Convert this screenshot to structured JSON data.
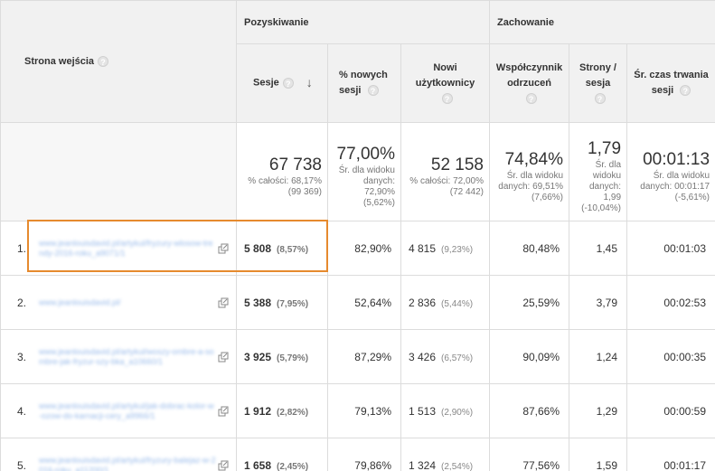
{
  "dimension_header": "Strona wejścia",
  "groups": {
    "acquisition": "Pozyskiwanie",
    "behavior": "Zachowanie"
  },
  "columns": {
    "sessions": "Sesje",
    "pct_new_sessions": "% nowych sesji",
    "new_users": "Nowi użytkownicy",
    "bounce_rate": "Współczynnik odrzuceń",
    "pages_per_session": "Strony / sesja",
    "avg_session_duration": "Śr. czas trwania sesji"
  },
  "help_glyph": "?",
  "sort_glyph": "↓",
  "totals": {
    "sessions": {
      "value": "67 738",
      "sub": "% całości: 68,17% (99 369)"
    },
    "pct_new_sessions": {
      "value": "77,00%",
      "sub": "Śr. dla widoku danych: 72,90% (5,62%)"
    },
    "new_users": {
      "value": "52 158",
      "sub": "% całości: 72,00% (72 442)"
    },
    "bounce_rate": {
      "value": "74,84%",
      "sub": "Śr. dla widoku danych: 69,51% (7,66%)"
    },
    "pages_per_session": {
      "value": "1,79",
      "sub": "Śr. dla widoku danych: 1,99 (-10,04%)"
    },
    "avg_session_duration": {
      "value": "00:01:13",
      "sub": "Śr. dla widoku danych: 00:01:17 (-5,61%)"
    }
  },
  "rows": [
    {
      "index": "1.",
      "url": "www.jeanlouisdavid.pl/artykul/fryzury-wlosow-trendy-2016-roku_a9071/1",
      "sessions": "5 808",
      "sessions_pct": "(8,57%)",
      "pct_new": "82,90%",
      "new_users": "4 815",
      "new_users_pct": "(9,23%)",
      "bounce": "80,48%",
      "pages": "1,45",
      "duration": "00:01:03"
    },
    {
      "index": "2.",
      "url": "www.jeanlouisdavid.pl/",
      "sessions": "5 388",
      "sessions_pct": "(7,95%)",
      "pct_new": "52,64%",
      "new_users": "2 836",
      "new_users_pct": "(5,44%)",
      "bounce": "25,59%",
      "pages": "3,79",
      "duration": "00:02:53"
    },
    {
      "index": "3.",
      "url": "www.jeanlouisdavid.pl/artykul/woszy-ombre-a-sombre-jak-fryzur-szy-bka_a10660/1",
      "sessions": "3 925",
      "sessions_pct": "(5,79%)",
      "pct_new": "87,29%",
      "new_users": "3 426",
      "new_users_pct": "(6,57%)",
      "bounce": "90,09%",
      "pages": "1,24",
      "duration": "00:00:35"
    },
    {
      "index": "4.",
      "url": "www.jeanlouisdavid.pl/artykul/jak-dobrac-kolor-w-ozow-do-karnacji-cery_a9966/1",
      "sessions": "1 912",
      "sessions_pct": "(2,82%)",
      "pct_new": "79,13%",
      "new_users": "1 513",
      "new_users_pct": "(2,90%)",
      "bounce": "87,66%",
      "pages": "1,29",
      "duration": "00:00:59"
    },
    {
      "index": "5.",
      "url": "www.jeanlouisdavid.pl/artykul/fryzury-balejaz-w-2016-roku_a11200/1",
      "sessions": "1 658",
      "sessions_pct": "(2,45%)",
      "pct_new": "79,86%",
      "new_users": "1 324",
      "new_users_pct": "(2,54%)",
      "bounce": "77,56%",
      "pages": "1,59",
      "duration": "00:01:17"
    }
  ],
  "colors": {
    "header_bg": "#f1f1f1",
    "border": "#dcdcdc",
    "highlight": "#e68a2e",
    "link": "#1a66c7"
  }
}
